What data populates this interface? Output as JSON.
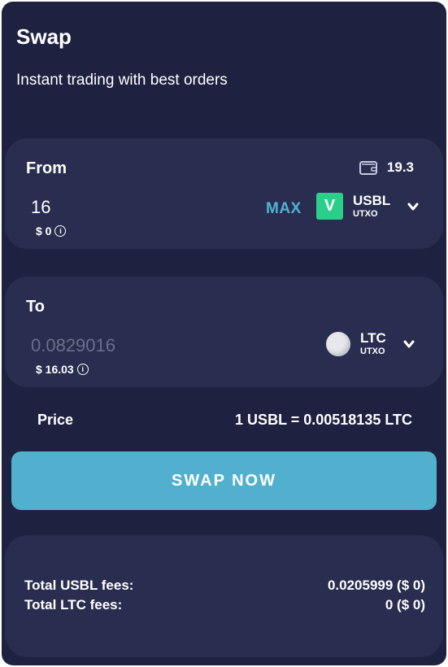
{
  "header": {
    "title": "Swap",
    "subtitle": "Instant trading with best orders"
  },
  "from": {
    "label": "From",
    "balance": "19.3",
    "amount": "16",
    "usd_value": "$ 0",
    "max_label": "MAX",
    "token": {
      "icon_letter": "V",
      "symbol": "USBL",
      "chain": "UTXO",
      "icon_color": "#2ccf8a"
    }
  },
  "to": {
    "label": "To",
    "amount": "0.0829016",
    "usd_value": "$ 16.03",
    "token": {
      "symbol": "LTC",
      "chain": "UTXO"
    }
  },
  "price": {
    "label": "Price",
    "value": "1 USBL = 0.00518135 LTC"
  },
  "swap_button": {
    "label": "SWAP NOW"
  },
  "fees": [
    {
      "label": "Total USBL fees:",
      "value": "0.0205999 ($ 0)"
    },
    {
      "label": "Total LTC fees:",
      "value": "0 ($ 0)"
    }
  ],
  "colors": {
    "background": "#1e2140",
    "card": "#292d4f",
    "accent": "#52b0cf",
    "max": "#4fb3d2"
  }
}
